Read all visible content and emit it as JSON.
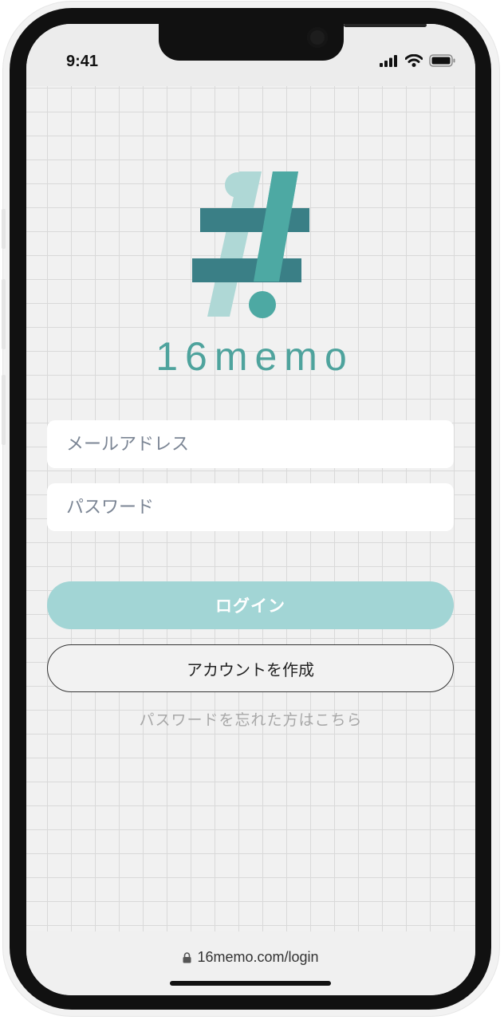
{
  "status_bar": {
    "time": "9:41",
    "icons": [
      "signal-icon",
      "wifi-icon",
      "battery-icon"
    ]
  },
  "brand": {
    "logo_icon": "hash-memo-logo-icon",
    "name": "16memo",
    "colors": {
      "teal_dark": "#3a7f86",
      "teal_mid": "#4da9a3",
      "teal_light": "#afd8d6"
    }
  },
  "form": {
    "email_placeholder": "メールアドレス",
    "password_placeholder": "パスワード",
    "login_label": "ログイン",
    "create_account_label": "アカウントを作成",
    "forgot_password_label": "パスワードを忘れた方はこちら"
  },
  "colors": {
    "login_button": "#a2d5d5",
    "background": "#f1f1f1",
    "grid_line": "#d9d9d9"
  },
  "address_bar": {
    "lock_icon": "lock-icon",
    "url": "16memo.com/login"
  }
}
